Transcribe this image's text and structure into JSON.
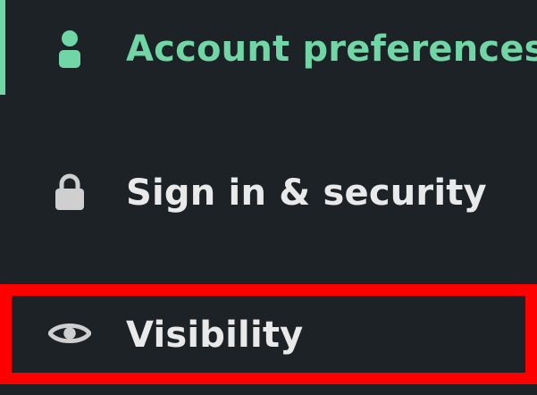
{
  "nav": {
    "items": [
      {
        "label": "Account preferences",
        "icon": "person-icon",
        "active": true
      },
      {
        "label": "Sign in & security",
        "icon": "lock-icon",
        "active": false
      },
      {
        "label": "Visibility",
        "icon": "eye-icon",
        "active": false,
        "highlighted": true
      }
    ]
  },
  "colors": {
    "background": "#1d2226",
    "active": "#71d6a5",
    "text": "#e9e9e9",
    "icon": "#cfcfcf",
    "highlight": "#ff0000"
  }
}
